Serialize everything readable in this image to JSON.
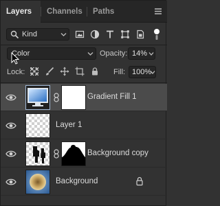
{
  "tabs": [
    {
      "label": "Layers",
      "active": true
    },
    {
      "label": "Channels",
      "active": false
    },
    {
      "label": "Paths",
      "active": false
    }
  ],
  "filter": {
    "kind_label": "Kind"
  },
  "blend": {
    "mode": "Color",
    "opacity_label": "Opacity:",
    "opacity_value": "14%"
  },
  "lock": {
    "label": "Lock:",
    "fill_label": "Fill:",
    "fill_value": "100%"
  },
  "layers": [
    {
      "name": "Gradient Fill 1",
      "selected": true
    },
    {
      "name": "Layer 1",
      "selected": false
    },
    {
      "name": "Background copy",
      "selected": false
    },
    {
      "name": "Background",
      "selected": false,
      "locked": true
    }
  ],
  "colors": {
    "panel": "#323232",
    "tabbar": "#262626",
    "selected_row": "#4b4b4b",
    "text": "#dcdcdc"
  }
}
